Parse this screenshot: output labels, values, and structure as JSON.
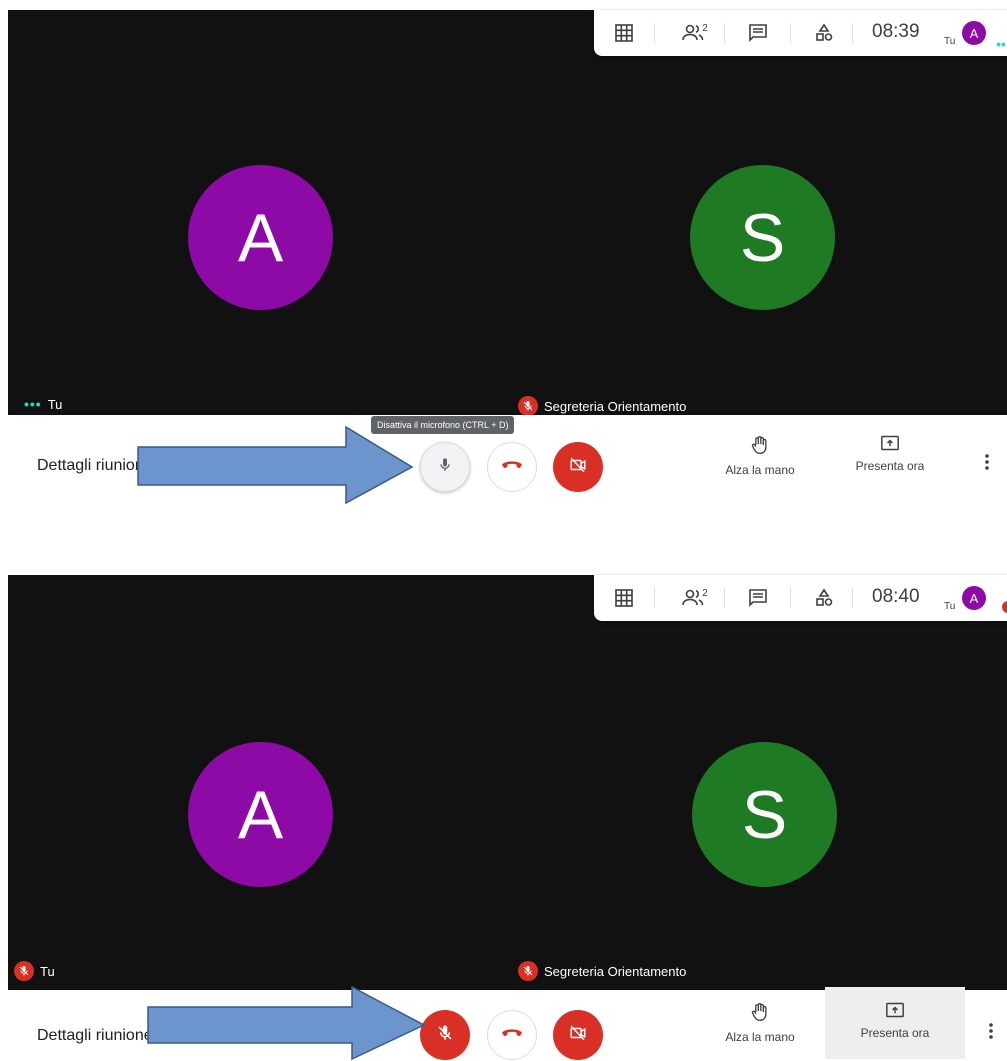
{
  "colors": {
    "stage_bg": "#111111",
    "avatar_a": "#8e0aa6",
    "avatar_s": "#1f7a24",
    "red": "#d93025",
    "teal": "#2bd7c0",
    "arrow_fill": "#6b95cc",
    "arrow_stroke": "#3b5a88"
  },
  "panels": [
    {
      "topbar": {
        "time": "08:39",
        "tu_label": "Tu",
        "avatar_letter": "A",
        "participants_count": "2"
      },
      "tiles": {
        "left_avatar": "A",
        "right_avatar": "S",
        "left_name": "Tu",
        "right_name": "Segreteria Orientamento",
        "left_speaking_dots": "•••"
      },
      "controls": {
        "details": "Dettagli riunione",
        "raise_hand": "Alza la mano",
        "present": "Presenta ora",
        "mic_state": "on"
      },
      "tooltip": "Disattiva il microfono (CTRL + D)"
    },
    {
      "topbar": {
        "time": "08:40",
        "tu_label": "Tu",
        "avatar_letter": "A",
        "participants_count": "2"
      },
      "tiles": {
        "left_avatar": "A",
        "right_avatar": "S",
        "left_name": "Tu",
        "right_name": "Segreteria Orientamento"
      },
      "controls": {
        "details": "Dettagli riunione",
        "raise_hand": "Alza la mano",
        "present": "Presenta ora",
        "mic_state": "muted"
      }
    }
  ],
  "icons": [
    "grid-icon",
    "people-icon",
    "chat-icon",
    "activities-icon",
    "mic-icon",
    "mic-off-icon",
    "hangup-icon",
    "camera-off-icon",
    "raise-hand-icon",
    "present-icon",
    "more-vert-icon",
    "arrow-annotation"
  ]
}
